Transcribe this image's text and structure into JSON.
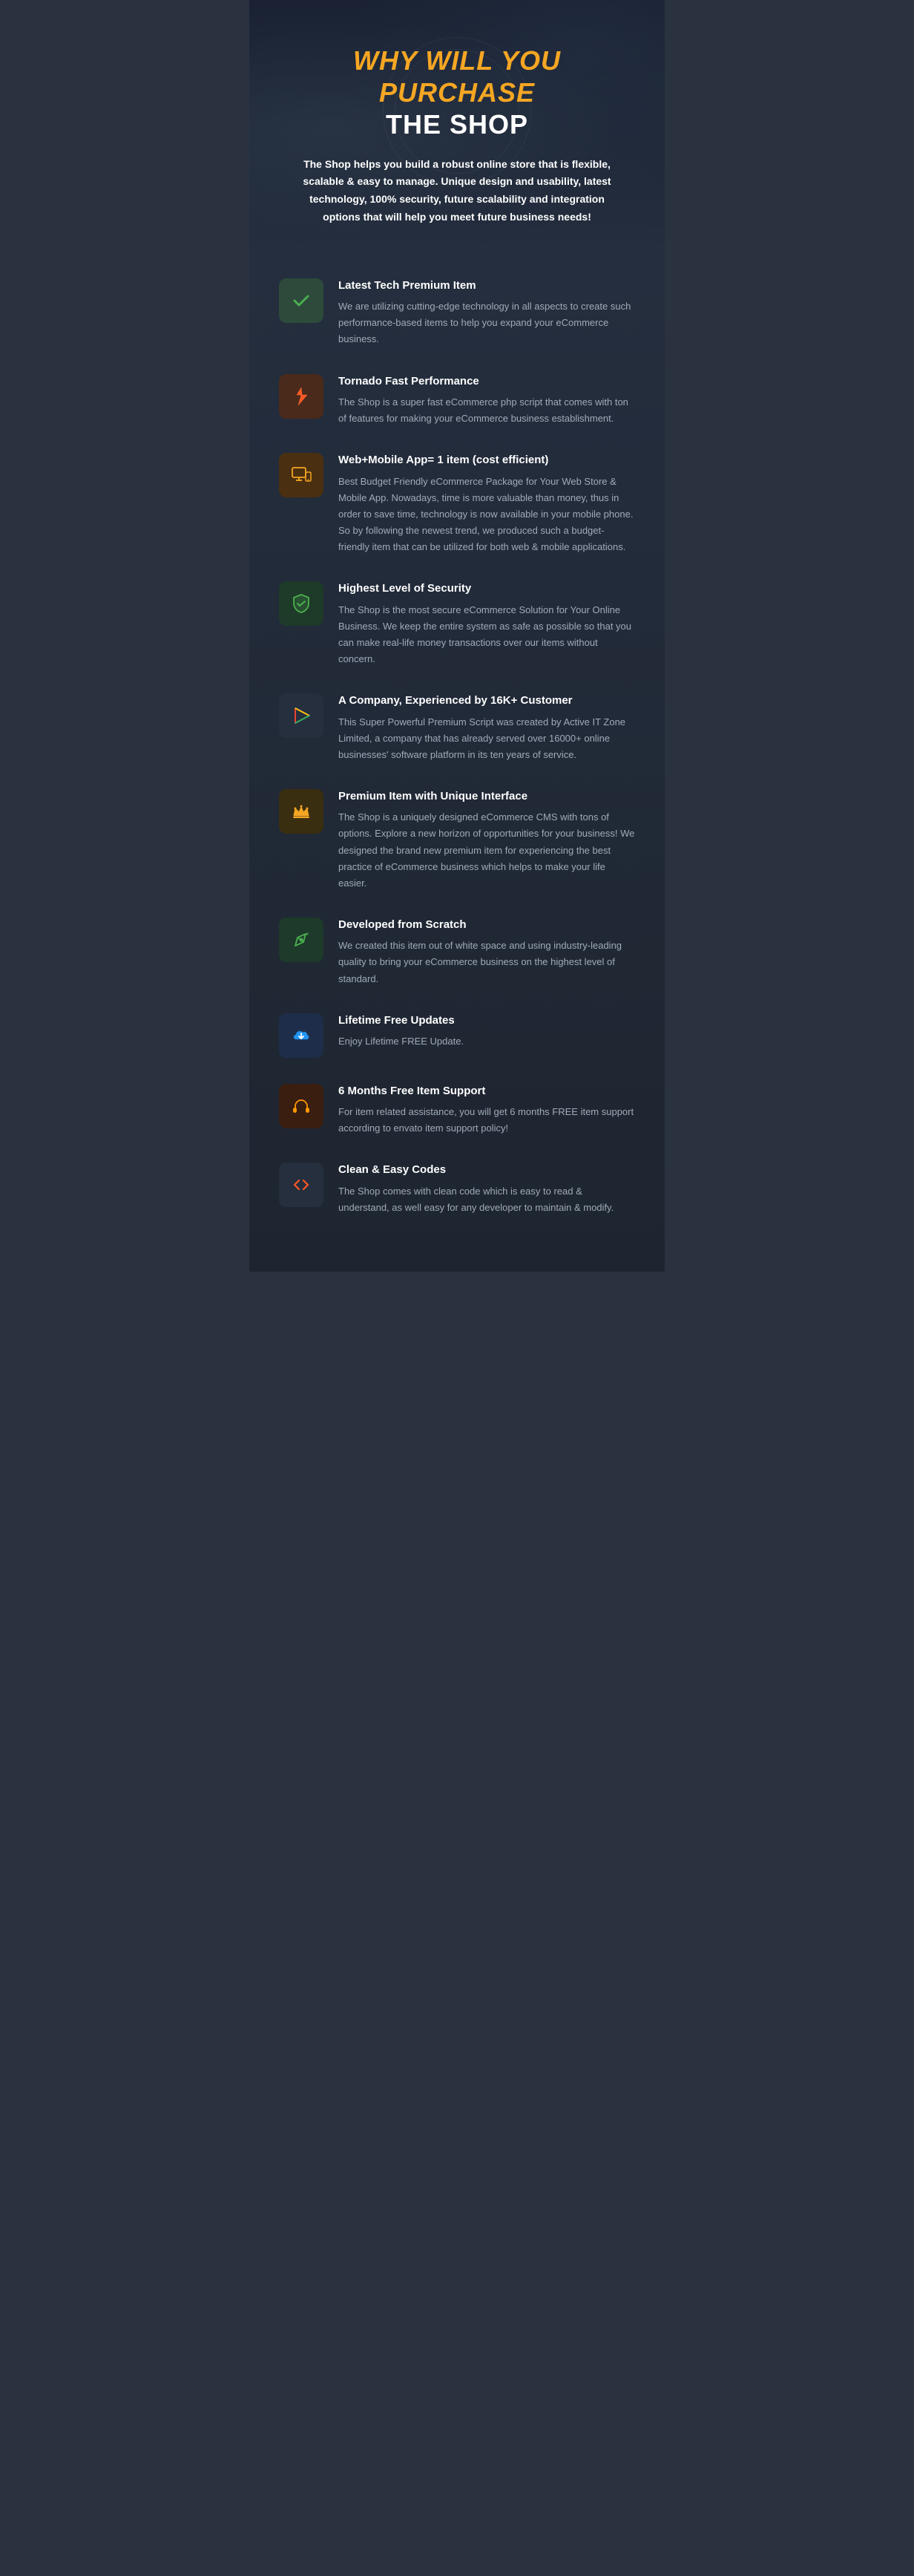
{
  "header": {
    "title_line1": "WHY WILL YOU PURCHASE",
    "title_line2": "THE SHOP",
    "subtitle": "The Shop helps you build a robust online store that is flexible, scalable & easy to manage. Unique design and usability, latest technology, 100% security, future scalability and integration options that will help you meet future business needs!"
  },
  "features": [
    {
      "id": "latest-tech",
      "icon_type": "checkmark",
      "icon_bg": "icon-green",
      "title": "Latest Tech Premium Item",
      "description": "We are utilizing cutting-edge technology in all aspects to create such performance-based items to help you expand your eCommerce business."
    },
    {
      "id": "tornado-fast",
      "icon_type": "rocket",
      "icon_bg": "icon-orange-red",
      "title": "Tornado Fast Performance",
      "description": "The Shop is a super fast eCommerce php script that comes with ton of features for making your eCommerce business establishment."
    },
    {
      "id": "web-mobile",
      "icon_type": "devices",
      "icon_bg": "icon-orange",
      "title": "Web+Mobile App= 1 item (cost efficient)",
      "description": "Best Budget Friendly eCommerce Package for Your Web Store & Mobile App. Nowadays, time is more valuable than money, thus in order to save time, technology is now available in your mobile phone. So by following the newest trend, we produced such a budget-friendly item that can be utilized for both web & mobile applications."
    },
    {
      "id": "security",
      "icon_type": "shield",
      "icon_bg": "icon-dark-green",
      "title": "Highest Level of Security",
      "description": "The Shop is the most secure eCommerce Solution for Your Online Business. We keep the entire system as safe as possible so that you can make real-life money transactions over our items without concern."
    },
    {
      "id": "company",
      "icon_type": "triangle",
      "icon_bg": "icon-dark-bg",
      "title": "A Company, Experienced by 16K+ Customer",
      "description": "This Super Powerful Premium Script was created by Active IT Zone Limited, a company that has already served over 16000+ online businesses' software platform in its ten years of service."
    },
    {
      "id": "premium",
      "icon_type": "crown",
      "icon_bg": "icon-gold",
      "title": "Premium Item with Unique Interface",
      "description": "The Shop is a uniquely designed eCommerce CMS with tons of options. Explore a new horizon of opportunities for your business!  We designed the brand new premium item for experiencing the best practice of eCommerce business which helps to make your life easier."
    },
    {
      "id": "scratch",
      "icon_type": "pencil",
      "icon_bg": "icon-green2",
      "title": "Developed from Scratch",
      "description": "We created this item out of white space and using industry-leading quality to bring your eCommerce business on the highest level of standard."
    },
    {
      "id": "updates",
      "icon_type": "cloud",
      "icon_bg": "icon-blue",
      "title": "Lifetime Free Updates",
      "description": "Enjoy Lifetime FREE Update."
    },
    {
      "id": "support",
      "icon_type": "headphone",
      "icon_bg": "icon-red-orange",
      "title": "6 Months Free Item Support",
      "description": "For item related assistance, you will get 6 months FREE item support according to envato item support policy!"
    },
    {
      "id": "clean-code",
      "icon_type": "code",
      "icon_bg": "icon-dark-code",
      "title": "Clean & Easy Codes",
      "description": "The Shop comes with clean code which is easy to read & understand, as well easy for any developer to maintain & modify."
    }
  ]
}
